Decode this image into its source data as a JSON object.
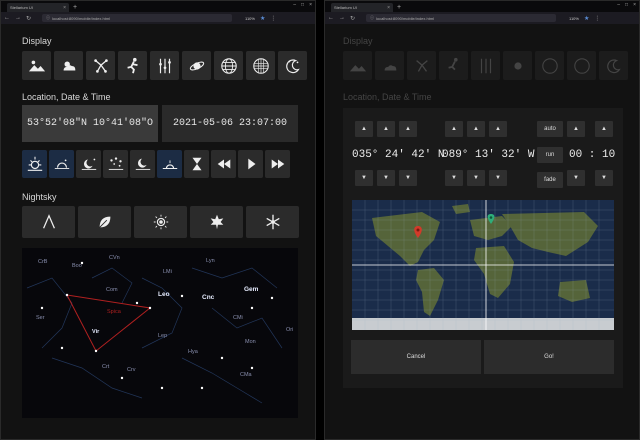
{
  "browser": {
    "tab_title": "Stellarium UI",
    "url": "localhost:8090/mobile/index.html",
    "zoom": "110%"
  },
  "left": {
    "display_title": "Display",
    "location_title": "Location, Date & Time",
    "location_value": "53°52'08\"N  10°41'08\"O",
    "datetime_value": "2021-05-06  23:07:00",
    "nightsky_title": "Nightsky",
    "constellations": [
      "CrB",
      "Boo",
      "CVn",
      "Com",
      "LMi",
      "Lyn",
      "Leo",
      "Cnc",
      "Gem",
      "Ser",
      "Spica",
      "Vir",
      "Crt",
      "Hya",
      "CMi",
      "Ori",
      "Lep",
      "Mon",
      "Crv",
      "CMa"
    ]
  },
  "right": {
    "display_title": "Display",
    "location_title": "Location, Date & Time",
    "lat": "035° 24' 42'  N",
    "lon": "089° 13' 32'  W",
    "time": "00 : 10",
    "auto_label": "auto",
    "run_label": "run",
    "fade_label": "fade",
    "cancel_label": "Cancel",
    "go_label": "Go!"
  },
  "colors": {
    "accent_blue": "#1c2c44",
    "marker_red": "#d23a2a",
    "marker_green": "#2fae7a",
    "constellation_red": "#b02020"
  }
}
